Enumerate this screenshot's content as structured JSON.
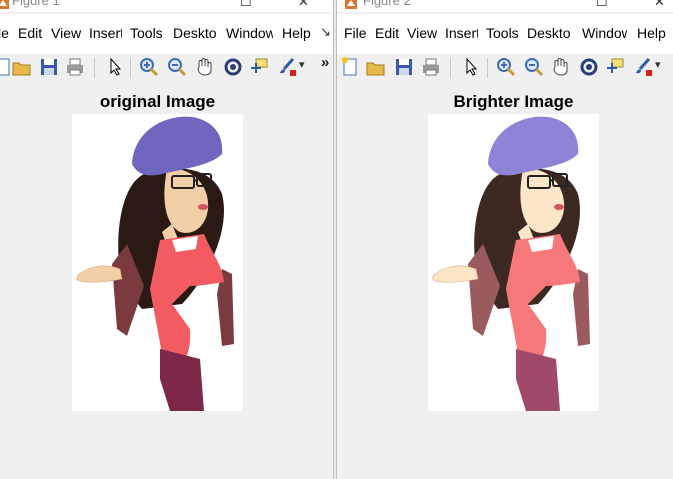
{
  "windows": [
    {
      "title": "Figure 1",
      "menu": [
        "le",
        "Edit",
        "View",
        "Insert",
        "Tools",
        "Deskto",
        "Window",
        "Help"
      ],
      "overflow_glyph": "↘",
      "toolbar_overflow": "»",
      "axes_title": "original Image",
      "image": {
        "brightness": "normal",
        "colors": {
          "hat": "#6f66c0",
          "hair": "#2b1a14",
          "skin": "#f3cfa8",
          "top": "#f25b5f",
          "sleeve": "#7a3a3e",
          "pants": "#7d2749"
        }
      }
    },
    {
      "title": "Figure 2",
      "menu": [
        "File",
        "Edit",
        "View",
        "Insert",
        "Tools",
        "Deskto",
        "Window",
        "Help"
      ],
      "axes_title": "Brighter Image",
      "image": {
        "brightness": "bright",
        "colors": {
          "hat": "#8d84d8",
          "hair": "#3c2a22",
          "skin": "#fbe6c8",
          "top": "#f7787b",
          "sleeve": "#9a5a5e",
          "pants": "#a04a6b"
        }
      }
    }
  ],
  "icons": [
    "new-figure-icon",
    "open-file-icon",
    "save-icon",
    "print-icon",
    "arrow-cursor-icon",
    "zoom-in-icon",
    "zoom-out-icon",
    "pan-hand-icon",
    "rotate-3d-icon",
    "data-cursor-icon",
    "brush-icon"
  ]
}
